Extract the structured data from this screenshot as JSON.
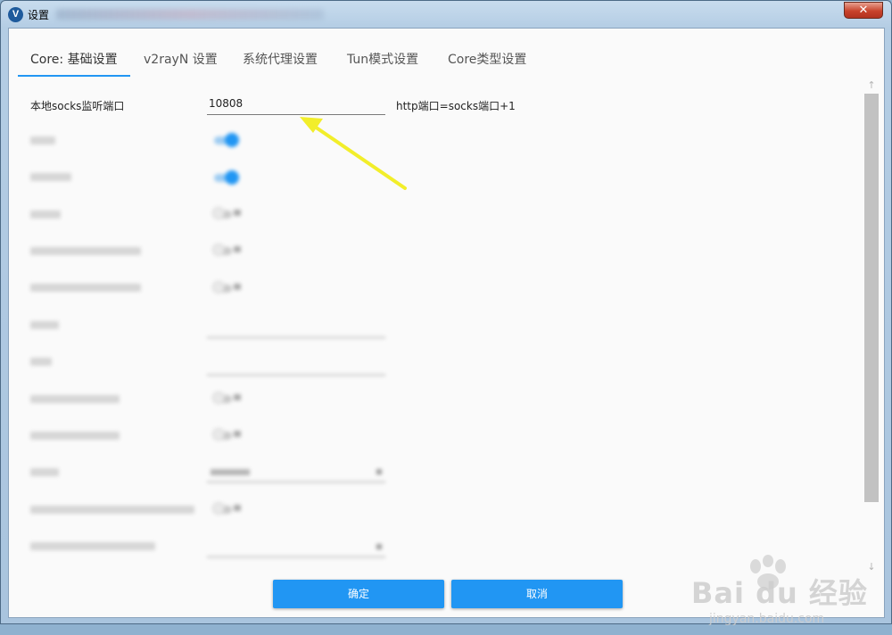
{
  "window": {
    "title": "设置",
    "close_glyph": "✕"
  },
  "tabs": [
    {
      "label": "Core: 基础设置",
      "active": true
    },
    {
      "label": "v2rayN 设置",
      "active": false
    },
    {
      "label": "系统代理设置",
      "active": false
    },
    {
      "label": "Tun模式设置",
      "active": false
    },
    {
      "label": "Core类型设置",
      "active": false
    }
  ],
  "settings": {
    "socks_port_label": "本地socks监听端口",
    "socks_port_value": "10808",
    "port_hint": "http端口=socks端口+1"
  },
  "buttons": {
    "ok": "确定",
    "cancel": "取消"
  },
  "watermark": {
    "brand": "Bai du 经验",
    "url": "jingyan.baidu.com"
  },
  "colors": {
    "accent": "#2196f3",
    "annotation_arrow": "#f2ee2a"
  }
}
